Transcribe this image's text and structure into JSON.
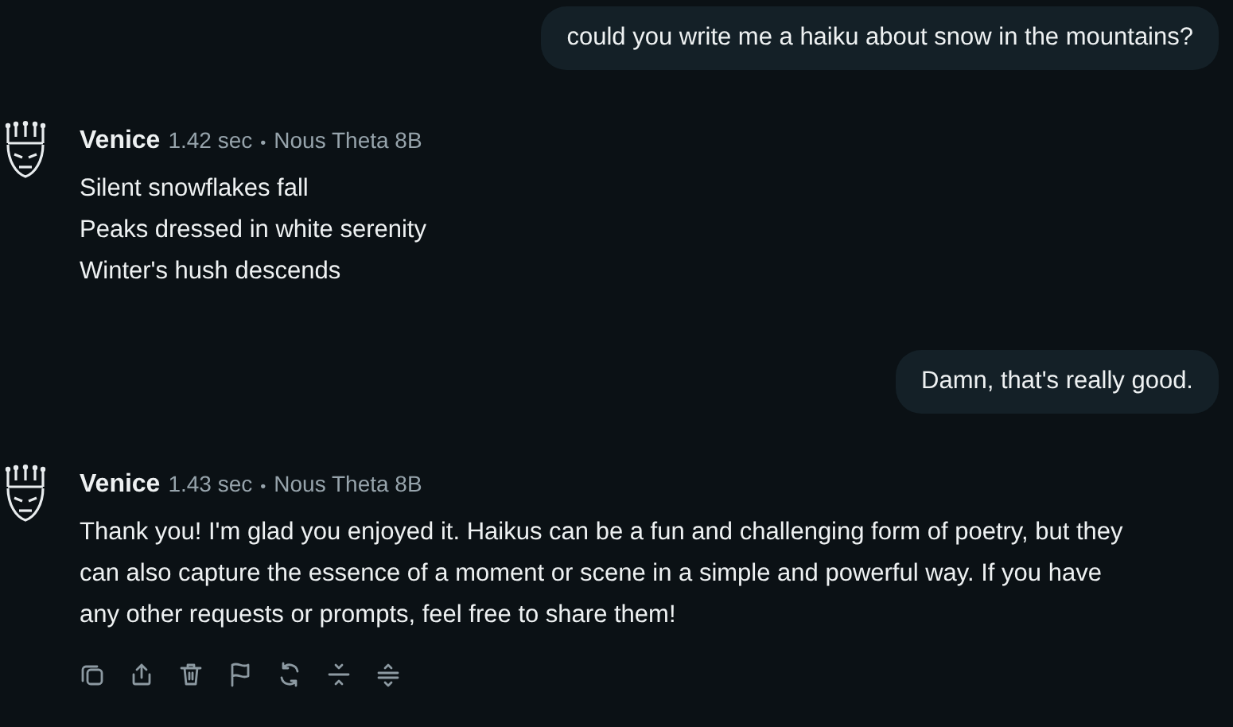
{
  "messages": [
    {
      "kind": "user",
      "text": "could you write me a haiku about snow in the mountains?"
    },
    {
      "kind": "assistant",
      "name": "Venice",
      "time": "1.42 sec",
      "bullet": "•",
      "model": "Nous Theta 8B",
      "paragraphs": [
        "Silent snowflakes fall",
        "Peaks dressed in white serenity",
        "Winter's hush descends"
      ],
      "actions": false
    },
    {
      "kind": "user",
      "text": "Damn, that's really good."
    },
    {
      "kind": "assistant",
      "name": "Venice",
      "time": "1.43 sec",
      "bullet": "•",
      "model": "Nous Theta 8B",
      "paragraphs": [
        "Thank you! I'm glad you enjoyed it. Haikus can be a fun and challenging form of poetry, but they can also capture the essence of a moment or scene in a simple and powerful way. If you have any other requests or prompts, feel free to share them!"
      ],
      "actions": true
    }
  ]
}
